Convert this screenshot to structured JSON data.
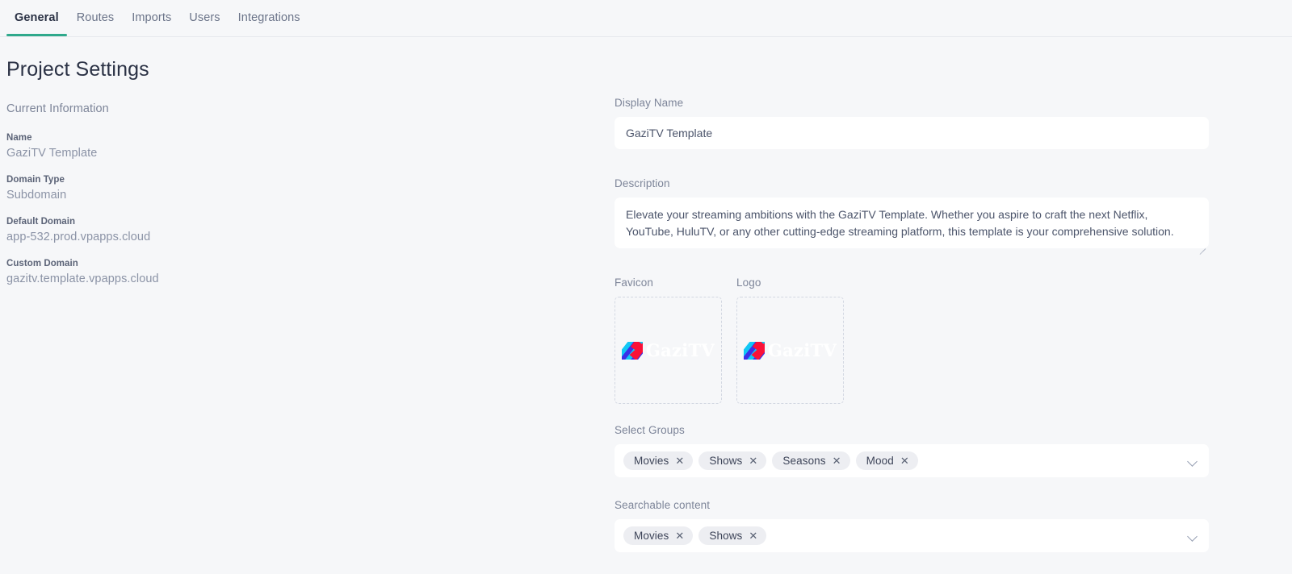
{
  "tabs": [
    {
      "label": "General",
      "active": true
    },
    {
      "label": "Routes",
      "active": false
    },
    {
      "label": "Imports",
      "active": false
    },
    {
      "label": "Users",
      "active": false
    },
    {
      "label": "Integrations",
      "active": false
    }
  ],
  "left": {
    "page_title": "Project Settings",
    "section_label": "Current Information",
    "info": [
      {
        "key": "Name",
        "value": "GaziTV Template"
      },
      {
        "key": "Domain Type",
        "value": "Subdomain"
      },
      {
        "key": "Default Domain",
        "value": "app-532.prod.vpapps.cloud"
      },
      {
        "key": "Custom Domain",
        "value": "gazitv.template.vpapps.cloud"
      }
    ]
  },
  "form": {
    "display_name": {
      "label": "Display Name",
      "value": "GaziTV Template",
      "placeholder": "Display Name"
    },
    "description": {
      "label": "Description",
      "value": "Elevate your streaming ambitions with the GaziTV Template. Whether you aspire to craft the next Netflix, YouTube, HuluTV, or any other cutting-edge streaming platform, this template is your comprehensive solution.",
      "placeholder": "Description"
    },
    "favicon": {
      "label": "Favicon",
      "logo_text": "GaziTV"
    },
    "logo": {
      "label": "Logo",
      "logo_text": "GaziTV"
    },
    "select_groups": {
      "label": "Select Groups",
      "tags": [
        "Movies",
        "Shows",
        "Seasons",
        "Mood"
      ],
      "remove_glyph": "✕",
      "chevron": "chevron-down-icon"
    },
    "searchable_content": {
      "label": "Searchable content",
      "tags": [
        "Movies",
        "Shows"
      ],
      "remove_glyph": "✕",
      "chevron": "chevron-down-icon"
    }
  },
  "colors": {
    "accent": "#2fa98c",
    "page_bg": "#f6f7f9",
    "input_bg": "#ffffff",
    "tag_bg": "#edeef2",
    "text_dark": "#2b3245",
    "text_muted": "#7d8599",
    "logo_cyan": "#12c7f5",
    "logo_blue": "#3b2fe8",
    "logo_red": "#fa1138"
  }
}
